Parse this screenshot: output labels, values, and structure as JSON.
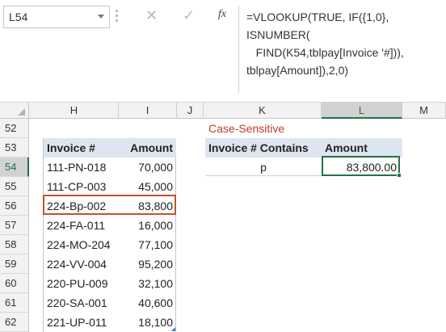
{
  "name_box": {
    "value": "L54"
  },
  "formula_bar": {
    "fx_label": "fx",
    "cancel_glyph": "✕",
    "enter_glyph": "✓",
    "formula_lines": [
      "=VLOOKUP(TRUE, IF({1,0},",
      "ISNUMBER(",
      "   FIND(K54,tblpay[Invoice '#])),",
      "tblpay[Amount]),2,0)"
    ]
  },
  "columns": [
    "H",
    "I",
    "J",
    "K",
    "L",
    "M"
  ],
  "active_column": "L",
  "rows": [
    "52",
    "53",
    "54",
    "55",
    "56",
    "57",
    "58",
    "59",
    "60",
    "61",
    "62"
  ],
  "active_row": "54",
  "lookup": {
    "title": "Case-Sensitive",
    "contains_label": "Invoice # Contains",
    "amount_label": "Amount",
    "search_value": "p",
    "result_value": "83,800.00"
  },
  "table": {
    "headers": {
      "invoice": "Invoice #",
      "amount": "Amount"
    },
    "rows": [
      {
        "invoice": "111-PN-018",
        "amount": "70,000"
      },
      {
        "invoice": "111-CP-003",
        "amount": "45,000"
      },
      {
        "invoice": "224-Bp-002",
        "amount": "83,800"
      },
      {
        "invoice": "224-FA-011",
        "amount": "16,000"
      },
      {
        "invoice": "224-MO-204",
        "amount": "77,100"
      },
      {
        "invoice": "224-VV-004",
        "amount": "95,200"
      },
      {
        "invoice": "220-PU-009",
        "amount": "32,100"
      },
      {
        "invoice": "220-SA-001",
        "amount": "40,600"
      },
      {
        "invoice": "221-UP-011",
        "amount": "18,100"
      }
    ],
    "highlighted_invoice": "224-Bp-002"
  },
  "colors": {
    "excel_green": "#217346",
    "highlight_border": "#c0552b",
    "title_red": "#c0392b",
    "header_fill": "#dde5f0"
  }
}
